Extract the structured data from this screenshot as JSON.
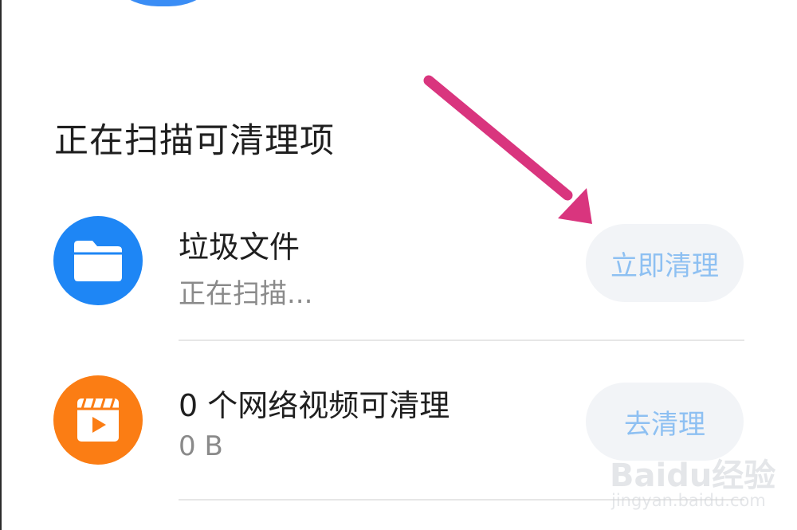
{
  "section": {
    "title": "正在扫描可清理项"
  },
  "items": [
    {
      "title": "垃圾文件",
      "subtitle": "正在扫描...",
      "button_label": "立即清理",
      "icon": "folder-icon",
      "icon_color": "#1e86f5"
    },
    {
      "title": "0 个网络视频可清理",
      "subtitle": "0 B",
      "button_label": "去清理",
      "icon": "video-icon",
      "icon_color": "#fb7d14"
    }
  ],
  "annotation": {
    "arrow_color": "#d9357e"
  },
  "watermark": {
    "brand": "Baidu经验",
    "url": "jingyan.baidu.com"
  },
  "colors": {
    "button_text": "#8ec0f2",
    "button_bg": "#f2f4f7",
    "top_arc": "#3a8df5"
  }
}
